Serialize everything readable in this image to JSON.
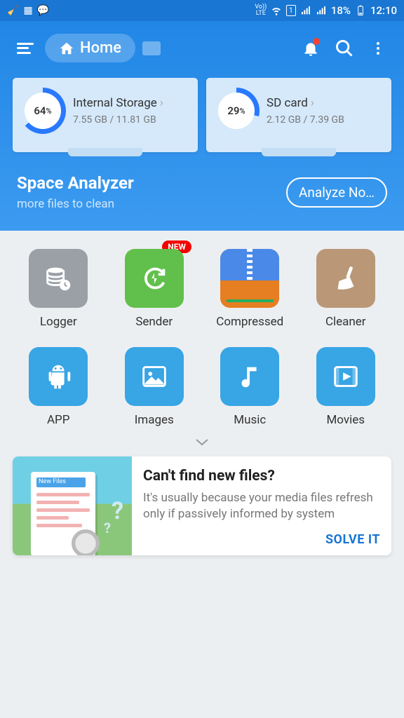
{
  "status": {
    "lte": "Vo)) LTE",
    "sim": "1",
    "battery_pct": "18%",
    "time": "12:10"
  },
  "header": {
    "home_label": "Home"
  },
  "storage": [
    {
      "name": "Internal Storage",
      "pct": "64",
      "pct_suffix": "%",
      "used": "7.55 GB",
      "total": "11.81 GB",
      "ring_deg": 230
    },
    {
      "name": "SD card",
      "pct": "29",
      "pct_suffix": "%",
      "used": "2.12 GB",
      "total": "7.39 GB",
      "ring_deg": 104
    }
  ],
  "analyzer": {
    "title": "Space Analyzer",
    "subtitle": "more files to clean",
    "button": "Analyze No…"
  },
  "tools": [
    {
      "label": "Logger",
      "icon": "stack-clock",
      "bg": "bg-grey",
      "badge": ""
    },
    {
      "label": "Sender",
      "icon": "refresh-bolt",
      "bg": "bg-green",
      "badge": "NEW"
    },
    {
      "label": "Compressed",
      "icon": "zip",
      "bg": "",
      "badge": ""
    },
    {
      "label": "Cleaner",
      "icon": "broom",
      "bg": "bg-brown",
      "badge": ""
    },
    {
      "label": "APP",
      "icon": "android",
      "bg": "bg-blue",
      "badge": ""
    },
    {
      "label": "Images",
      "icon": "picture",
      "bg": "bg-blue",
      "badge": ""
    },
    {
      "label": "Music",
      "icon": "note",
      "bg": "bg-blue",
      "badge": ""
    },
    {
      "label": "Movies",
      "icon": "play",
      "bg": "bg-blue",
      "badge": ""
    }
  ],
  "promo": {
    "heading": "Can't find new files?",
    "body": "It's usually because your media files refresh only if passively informed by system",
    "action": "SOLVE IT",
    "illus_label": "New Files"
  }
}
